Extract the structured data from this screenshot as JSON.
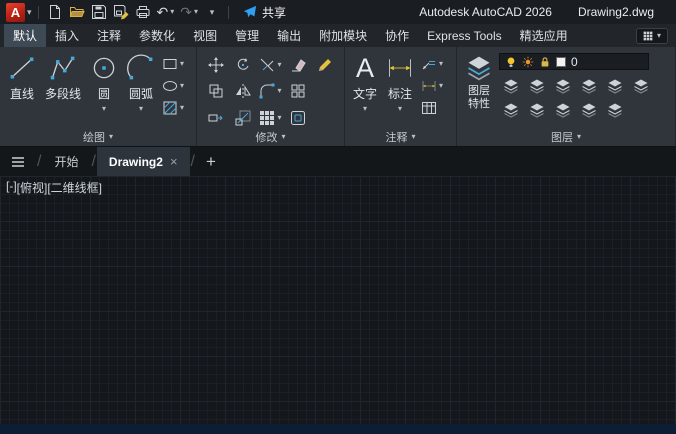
{
  "titlebar": {
    "logo": "A",
    "share_label": "共享",
    "app_title": "Autodesk AutoCAD 2026",
    "doc_title": "Drawing2.dwg"
  },
  "icons": {
    "caret": "▾",
    "undo": "↶",
    "redo": "↷",
    "close": "×",
    "add": "+",
    "slash": "/",
    "text_tool": "A"
  },
  "ribbon": {
    "tabs": [
      "默认",
      "插入",
      "注释",
      "参数化",
      "视图",
      "管理",
      "输出",
      "附加模块",
      "协作",
      "Express Tools",
      "精选应用"
    ],
    "active_tab": "默认",
    "panels": {
      "draw": {
        "label": "绘图",
        "tools": [
          "直线",
          "多段线",
          "圆",
          "圆弧"
        ]
      },
      "modify": {
        "label": "修改"
      },
      "annotate": {
        "label": "注释",
        "tools": [
          "文字",
          "标注"
        ]
      },
      "layers": {
        "label": "图层",
        "properties_label": "图层特性",
        "current_layer": "0"
      }
    }
  },
  "file_tabs": {
    "start": "开始",
    "document": "Drawing2"
  },
  "viewport": {
    "controls": [
      "[-]",
      "[俯视]",
      "[二维线框]"
    ]
  },
  "colors": {
    "logo_red": "#c7281d",
    "share_blue": "#2f9ff0",
    "accent_teal": "#4aa8d8",
    "bulb_yellow": "#f2c430",
    "sun_orange": "#e8962e",
    "active_tab": "#3e4956"
  }
}
